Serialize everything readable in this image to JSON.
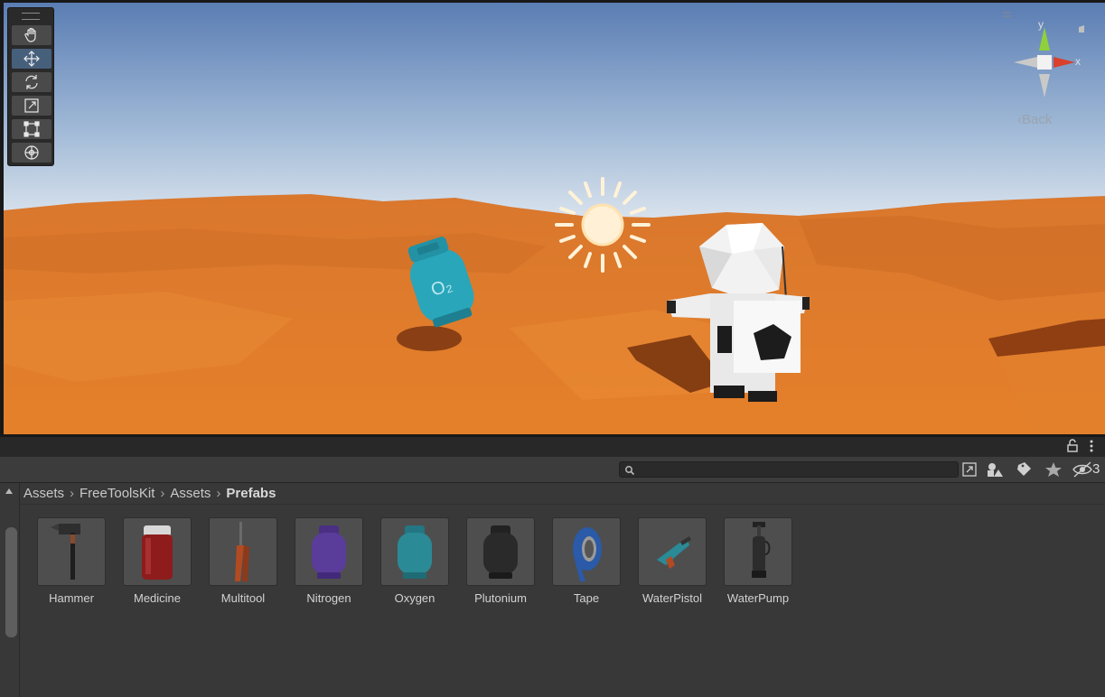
{
  "scene": {
    "gizmo": {
      "x_label": "x",
      "y_label": "y",
      "back_label": "Back"
    },
    "oxygen_label": "O₂",
    "tools": [
      {
        "name": "hand-tool",
        "icon": "hand-icon",
        "active": false
      },
      {
        "name": "move-tool",
        "icon": "move-icon",
        "active": true
      },
      {
        "name": "rotate-tool",
        "icon": "rotate-icon",
        "active": false
      },
      {
        "name": "scale-tool",
        "icon": "scale-icon",
        "active": false
      },
      {
        "name": "rect-tool",
        "icon": "rect-icon",
        "active": false
      },
      {
        "name": "transform-tool",
        "icon": "transform-icon",
        "active": false
      }
    ]
  },
  "project": {
    "search": {
      "value": "",
      "placeholder": ""
    },
    "hidden_count": "3",
    "breadcrumb": [
      "Assets",
      "FreeToolsKit",
      "Assets",
      "Prefabs"
    ],
    "assets": [
      {
        "label": "Hammer",
        "icon": "hammer-icon"
      },
      {
        "label": "Medicine",
        "icon": "medicine-bottle-icon"
      },
      {
        "label": "Multitool",
        "icon": "multitool-icon"
      },
      {
        "label": "Nitrogen",
        "icon": "gas-tank-icon",
        "color": "#5a3c9a"
      },
      {
        "label": "Oxygen",
        "icon": "gas-tank-icon",
        "color": "#2a8a96"
      },
      {
        "label": "Plutonium",
        "icon": "gas-tank-icon",
        "color": "#2a2a2a"
      },
      {
        "label": "Tape",
        "icon": "tape-icon"
      },
      {
        "label": "WaterPistol",
        "icon": "water-pistol-icon"
      },
      {
        "label": "WaterPump",
        "icon": "water-pump-icon"
      }
    ]
  },
  "colors": {
    "sky_top": "#5c7fb5",
    "sky_bottom": "#c7d6e6",
    "sand": "#e07b2a",
    "active_tool": "#46607c",
    "panel_bg": "#383838"
  }
}
